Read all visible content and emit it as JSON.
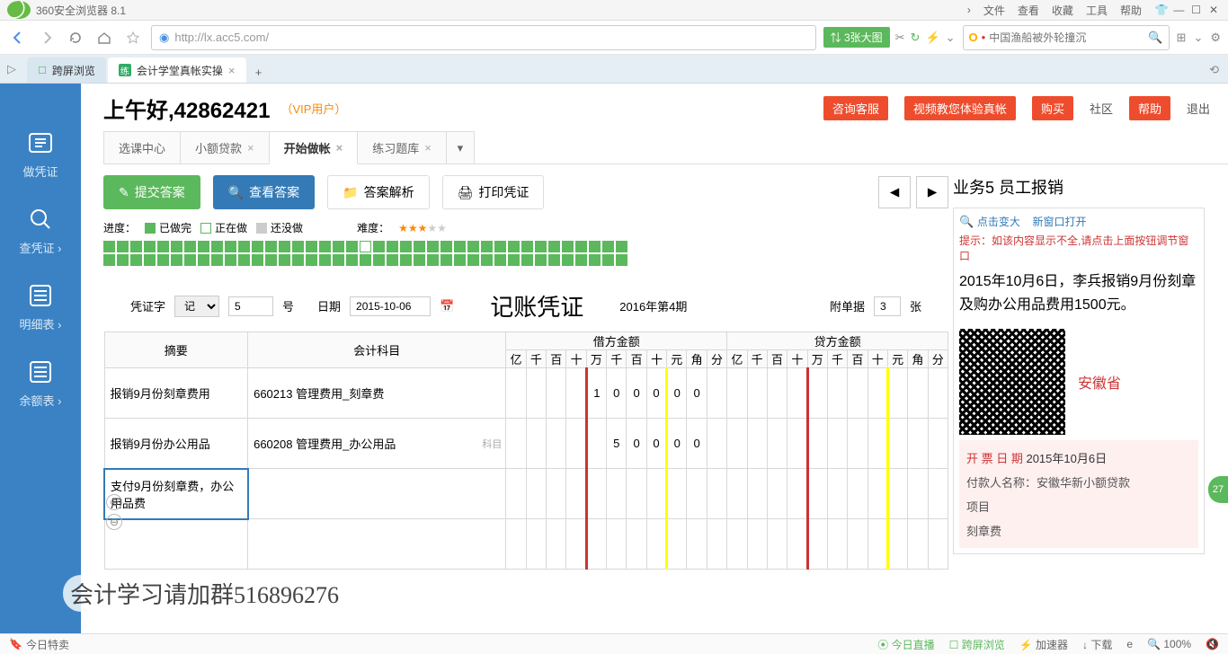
{
  "browser": {
    "app_title": "360安全浏览器 8.1",
    "menu": [
      "文件",
      "查看",
      "收藏",
      "工具",
      "帮助"
    ],
    "url": "http://lx.acc5.com/",
    "green_action": "⇅ 3张大图",
    "search_placeholder": "中国渔船被外轮撞沉",
    "tabs": [
      {
        "label": "跨屏浏览",
        "active": false
      },
      {
        "label": "会计学堂真帐实操",
        "active": true
      }
    ]
  },
  "header": {
    "greeting": "上午好,42862421",
    "vip": "（VIP用户）",
    "links": {
      "consult": "咨询客服",
      "video": "视频教您体验真帐",
      "buy": "购买",
      "community": "社区",
      "help": "帮助",
      "exit": "退出"
    }
  },
  "section_tabs": [
    {
      "label": "选课中心",
      "closable": false
    },
    {
      "label": "小额贷款",
      "closable": true
    },
    {
      "label": "开始做帐",
      "closable": true,
      "active": true
    },
    {
      "label": "练习题库",
      "closable": true
    }
  ],
  "sidebar": [
    {
      "label": "做凭证",
      "icon": "doc"
    },
    {
      "label": "查凭证 ›",
      "icon": "search"
    },
    {
      "label": "明细表 ›",
      "icon": "list"
    },
    {
      "label": "余额表 ›",
      "icon": "list"
    }
  ],
  "toolbar": {
    "submit": "提交答案",
    "view": "查看答案",
    "analyze": "答案解析",
    "print": "打印凭证"
  },
  "progress": {
    "label": "进度：",
    "done": "已做完",
    "doing": "正在做",
    "todo": "还没做",
    "difficulty_label": "难度：",
    "stars": 3
  },
  "voucher": {
    "word_label": "凭证字",
    "word_value": "记",
    "number": "5",
    "unit": "号",
    "date_label": "日期",
    "date_value": "2015-10-06",
    "title": "记账凭证",
    "period": "2016年第4期",
    "attach_label": "附单据",
    "attach_value": "3",
    "attach_unit": "张",
    "headers": {
      "summary": "摘要",
      "subject": "会计科目",
      "debit": "借方金额",
      "credit": "贷方金额",
      "digits": [
        "亿",
        "千",
        "百",
        "十",
        "万",
        "千",
        "百",
        "十",
        "元",
        "角",
        "分"
      ]
    },
    "rows": [
      {
        "summary": "报销9月份刻章费用",
        "subject": "660213 管理费用_刻章费",
        "debit": [
          "",
          "",
          "",
          "",
          "1",
          "0",
          "0",
          "0",
          "0",
          "0",
          ""
        ]
      },
      {
        "summary": "报销9月份办公用品",
        "subject": "660208 管理费用_办公用品",
        "subject_tag": "科目",
        "debit": [
          "",
          "",
          "",
          "",
          "",
          "5",
          "0",
          "0",
          "0",
          "0",
          ""
        ]
      },
      {
        "summary": "支付9月份刻章费，办公用品费",
        "subject": "",
        "editing": true
      }
    ]
  },
  "right_panel": {
    "biz_title": "业务5  员工报销",
    "zoom": "点击变大",
    "newwin": "新窗口打开",
    "tip_label": "提示：",
    "tip": "如该内容显示不全,请点击上面按钮调节窗口",
    "desc": "2015年10月6日，李兵报销9月份刻章及购办公用品费用1500元。",
    "qr_side": "安徽省",
    "invoice": {
      "date_label": "开 票 日 期",
      "date_value": "2015年10月6日",
      "payer_label": "付款人名称：",
      "payer_value": "安徽华新小额贷款",
      "item_label": "项目",
      "item1": "刻章费"
    }
  },
  "float_badge": "27",
  "qun_text": "会计学习请加群516896276",
  "status_bar": {
    "left": "今日特卖",
    "right": [
      "今日直播",
      "跨屏浏览",
      "加速器",
      "下载",
      "e",
      "100%"
    ]
  }
}
